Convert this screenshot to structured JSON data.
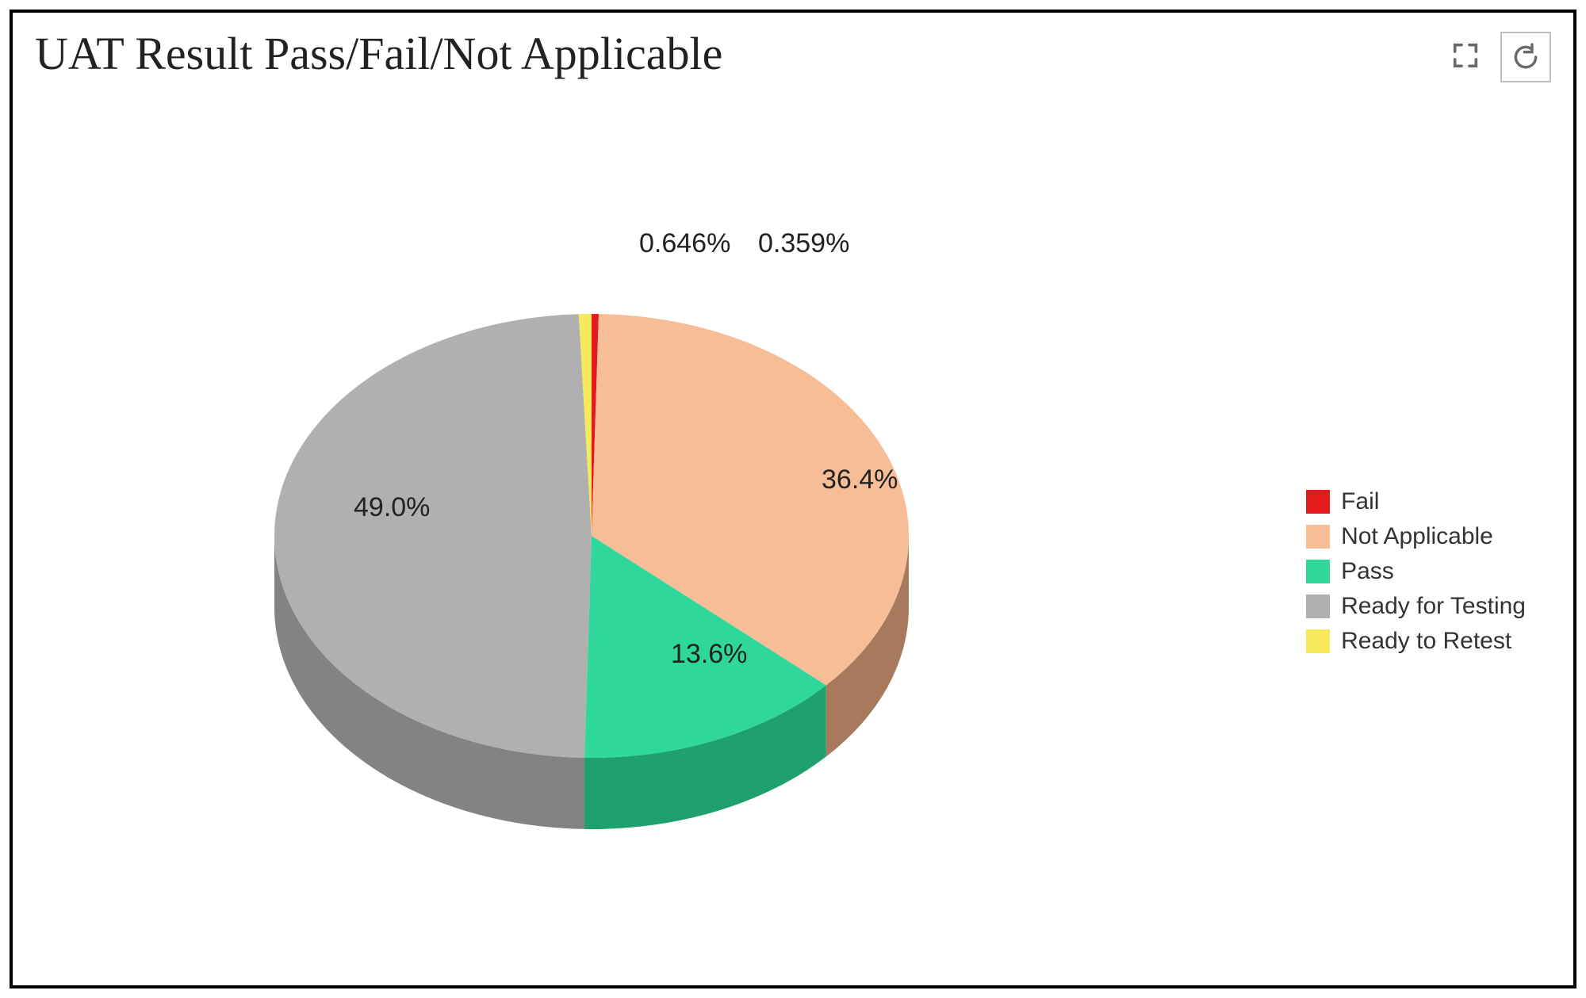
{
  "header": {
    "title": "UAT Result Pass/Fail/Not Applicable"
  },
  "chart_data": {
    "type": "pie",
    "title": "UAT Result Pass/Fail/Not Applicable",
    "series": [
      {
        "name": "Fail",
        "value": 0.359,
        "label": "0.359%",
        "color": "#e41a1c",
        "side_color": "#b81416"
      },
      {
        "name": "Not Applicable",
        "value": 36.4,
        "label": "36.4%",
        "color": "#f7bd97",
        "side_color": "#a77a5e"
      },
      {
        "name": "Pass",
        "value": 13.6,
        "label": "13.6%",
        "color": "#2fd89a",
        "side_color": "#1fa06f"
      },
      {
        "name": "Ready for Testing",
        "value": 49.0,
        "label": "49.0%",
        "color": "#b0b0b0",
        "side_color": "#838383"
      },
      {
        "name": "Ready to Retest",
        "value": 0.646,
        "label": "0.646%",
        "color": "#f7ea5a",
        "side_color": "#c9be47"
      }
    ],
    "legend_position": "right"
  }
}
